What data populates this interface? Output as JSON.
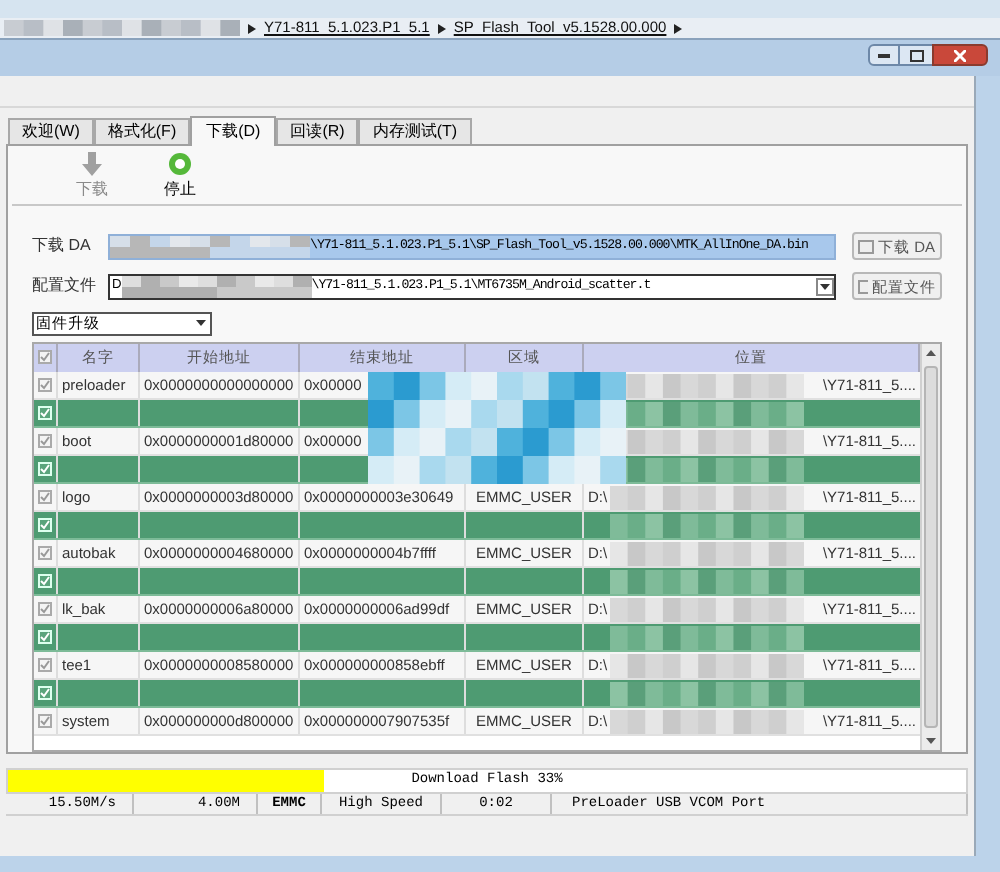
{
  "breadcrumb": [
    "Y71-811_5.1.023.P1_5.1",
    "SP_Flash_Tool_v5.1528.00.000"
  ],
  "tabs": [
    {
      "label": "欢迎(W)",
      "selected": false
    },
    {
      "label": "格式化(F)",
      "selected": false
    },
    {
      "label": "下载(D)",
      "selected": true
    },
    {
      "label": "回读(R)",
      "selected": false
    },
    {
      "label": "内存测试(T)",
      "selected": false
    }
  ],
  "toolbar": [
    {
      "kind": "download",
      "label": "下载",
      "disabled": true
    },
    {
      "kind": "stop",
      "label": "停止",
      "disabled": false
    }
  ],
  "da_field": {
    "label": "下载 DA",
    "value_end": "\\Y71-811_5.1.023.P1_5.1\\SP_Flash_Tool_v5.1528.00.000\\MTK_AllInOne_DA.bin",
    "button": "下载 DA"
  },
  "scatter_field": {
    "label": "配置文件",
    "value_start": "D",
    "value_end": "\\Y71-811_5.1.023.P1_5.1\\MT6735M_Android_scatter.t",
    "button": "配置文件"
  },
  "mode_dropdown": {
    "value": "固件升级"
  },
  "table": {
    "header_checked": true,
    "columns": [
      "名字",
      "开始地址",
      "结束地址",
      "区域",
      "位置"
    ],
    "rows": [
      {
        "highlighted": false,
        "checked": true,
        "name": "preloader",
        "start": "0x0000000000000000",
        "end": "0x00000",
        "location_end": "\\Y71-811_5...."
      },
      {
        "highlighted": true,
        "checked": true
      },
      {
        "highlighted": false,
        "checked": true,
        "name": "boot",
        "start": "0x0000000001d80000",
        "end": "0x00000",
        "location_end": "\\Y71-811_5...."
      },
      {
        "highlighted": true,
        "checked": true
      },
      {
        "highlighted": false,
        "checked": true,
        "name": "logo",
        "start": "0x0000000003d80000",
        "end": "0x0000000003e30649",
        "region": "EMMC_USER",
        "location_start": "D:\\",
        "location_end": "\\Y71-811_5...."
      },
      {
        "highlighted": true,
        "checked": true
      },
      {
        "highlighted": false,
        "checked": true,
        "name": "autobak",
        "start": "0x0000000004680000",
        "end": "0x0000000004b7ffff",
        "region": "EMMC_USER",
        "location_start": "D:\\",
        "location_end": "\\Y71-811_5...."
      },
      {
        "highlighted": true,
        "checked": true
      },
      {
        "highlighted": false,
        "checked": true,
        "name": "lk_bak",
        "start": "0x0000000006a80000",
        "end": "0x0000000006ad99df",
        "region": "EMMC_USER",
        "location_start": "D:\\",
        "location_end": "\\Y71-811_5...."
      },
      {
        "highlighted": true,
        "checked": true
      },
      {
        "highlighted": false,
        "checked": true,
        "name": "tee1",
        "start": "0x0000000008580000",
        "end": "0x000000000858ebff",
        "region": "EMMC_USER",
        "location_start": "D:\\",
        "location_end": "\\Y71-811_5...."
      },
      {
        "highlighted": true,
        "checked": true
      },
      {
        "highlighted": false,
        "checked": true,
        "name": "system",
        "start": "0x000000000d800000",
        "end": "0x000000007907535f",
        "region": "EMMC_USER",
        "location_start": "D:\\",
        "location_end": "\\Y71-811_5...."
      }
    ]
  },
  "progress": {
    "level": 0.33,
    "text": "Download Flash 33%"
  },
  "status_bar": [
    {
      "kind": "plain",
      "text": "15.50M/s"
    },
    {
      "kind": "plain",
      "text": "4.00M"
    },
    {
      "kind": "bold",
      "text": "EMMC"
    },
    {
      "kind": "plain",
      "text": "High Speed"
    },
    {
      "kind": "plain",
      "text": "0:02"
    },
    {
      "kind": "plain",
      "text": "PreLoader USB VCOM Port"
    }
  ]
}
